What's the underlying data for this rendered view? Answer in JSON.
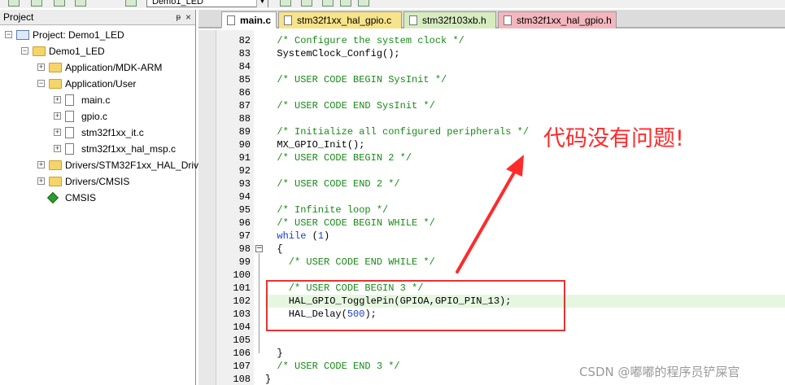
{
  "toolbar": {
    "target_combo": "Demo1_LED"
  },
  "project_panel": {
    "title": "Project",
    "pin": "ᵽ",
    "close": "×",
    "tree": [
      {
        "label": "Project: Demo1_LED",
        "level": 0,
        "icon": "project-icon",
        "expander": "minus"
      },
      {
        "label": "Demo1_LED",
        "level": 1,
        "icon": "target-folder-icon",
        "expander": "minus"
      },
      {
        "label": "Application/MDK-ARM",
        "level": 2,
        "icon": "folder-icon",
        "expander": "plus"
      },
      {
        "label": "Application/User",
        "level": 2,
        "icon": "folder-icon",
        "expander": "minus"
      },
      {
        "label": "main.c",
        "level": 3,
        "icon": "file-icon",
        "expander": "plus"
      },
      {
        "label": "gpio.c",
        "level": 3,
        "icon": "file-icon",
        "expander": "plus"
      },
      {
        "label": "stm32f1xx_it.c",
        "level": 3,
        "icon": "file-icon",
        "expander": "plus"
      },
      {
        "label": "stm32f1xx_hal_msp.c",
        "level": 3,
        "icon": "file-icon",
        "expander": "plus"
      },
      {
        "label": "Drivers/STM32F1xx_HAL_Driv",
        "level": 2,
        "icon": "folder-icon",
        "expander": "plus"
      },
      {
        "label": "Drivers/CMSIS",
        "level": 2,
        "icon": "folder-icon",
        "expander": "plus"
      },
      {
        "label": "CMSIS",
        "level": 2,
        "icon": "cmsis-diamond-icon",
        "expander": "none"
      }
    ]
  },
  "editor": {
    "tabs": [
      {
        "label": "main.c",
        "color": "#ffffff",
        "active": true
      },
      {
        "label": "stm32f1xx_hal_gpio.c",
        "color": "#f7e38a",
        "active": false
      },
      {
        "label": "stm32f103xb.h",
        "color": "#d6ecc0",
        "active": false
      },
      {
        "label": "stm32f1xx_hal_gpio.h",
        "color": "#f4b6bd",
        "active": false
      }
    ],
    "lines": [
      {
        "n": "82",
        "parts": [
          [
            "c-comment",
            "  /* Configure the system clock */"
          ]
        ]
      },
      {
        "n": "83",
        "parts": [
          [
            "c-plain",
            "  SystemClock_Config();"
          ]
        ]
      },
      {
        "n": "84",
        "parts": [
          [
            "c-plain",
            ""
          ]
        ]
      },
      {
        "n": "85",
        "parts": [
          [
            "c-comment",
            "  /* USER CODE BEGIN SysInit */"
          ]
        ]
      },
      {
        "n": "86",
        "parts": [
          [
            "c-plain",
            ""
          ]
        ]
      },
      {
        "n": "87",
        "parts": [
          [
            "c-comment",
            "  /* USER CODE END SysInit */"
          ]
        ]
      },
      {
        "n": "88",
        "parts": [
          [
            "c-plain",
            ""
          ]
        ]
      },
      {
        "n": "89",
        "parts": [
          [
            "c-comment",
            "  /* Initialize all configured peripherals */"
          ]
        ]
      },
      {
        "n": "90",
        "parts": [
          [
            "c-plain",
            "  MX_GPIO_Init();"
          ]
        ]
      },
      {
        "n": "91",
        "parts": [
          [
            "c-comment",
            "  /* USER CODE BEGIN 2 */"
          ]
        ]
      },
      {
        "n": "92",
        "parts": [
          [
            "c-plain",
            ""
          ]
        ]
      },
      {
        "n": "93",
        "parts": [
          [
            "c-comment",
            "  /* USER CODE END 2 */"
          ]
        ]
      },
      {
        "n": "94",
        "parts": [
          [
            "c-plain",
            ""
          ]
        ]
      },
      {
        "n": "95",
        "parts": [
          [
            "c-comment",
            "  /* Infinite loop */"
          ]
        ]
      },
      {
        "n": "96",
        "parts": [
          [
            "c-comment",
            "  /* USER CODE BEGIN WHILE */"
          ]
        ]
      },
      {
        "n": "97",
        "parts": [
          [
            "c-kw",
            "  while"
          ],
          [
            "c-plain",
            " ("
          ],
          [
            "c-num",
            "1"
          ],
          [
            "c-plain",
            ")"
          ]
        ]
      },
      {
        "n": "98",
        "parts": [
          [
            "c-plain",
            "  {"
          ]
        ]
      },
      {
        "n": "99",
        "parts": [
          [
            "c-comment",
            "    /* USER CODE END WHILE */"
          ]
        ]
      },
      {
        "n": "100",
        "parts": [
          [
            "c-plain",
            ""
          ]
        ]
      },
      {
        "n": "101",
        "parts": [
          [
            "c-comment",
            "    /* USER CODE BEGIN 3 */"
          ]
        ]
      },
      {
        "n": "102",
        "parts": [
          [
            "c-plain",
            "    HAL_GPIO_TogglePin(GPIOA,GPIO_PIN_13);"
          ]
        ],
        "highlight": true
      },
      {
        "n": "103",
        "parts": [
          [
            "c-plain",
            "    HAL_Delay("
          ],
          [
            "c-num",
            "500"
          ],
          [
            "c-plain",
            ");"
          ]
        ]
      },
      {
        "n": "104",
        "parts": [
          [
            "c-plain",
            ""
          ]
        ]
      },
      {
        "n": "105",
        "parts": [
          [
            "c-plain",
            ""
          ]
        ]
      },
      {
        "n": "106",
        "parts": [
          [
            "c-plain",
            "  }"
          ]
        ]
      },
      {
        "n": "107",
        "parts": [
          [
            "c-comment",
            "  /* USER CODE END 3 */"
          ]
        ]
      },
      {
        "n": "108",
        "parts": [
          [
            "c-plain",
            "}"
          ]
        ]
      }
    ]
  },
  "annotation": {
    "text": "代码没有问题!",
    "color": "#ff2b2b"
  },
  "watermark": "CSDN @嘟嘟的程序员铲屎官"
}
